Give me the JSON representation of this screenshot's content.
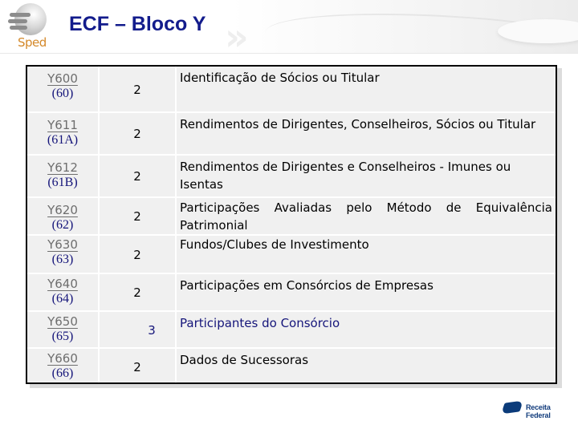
{
  "header": {
    "title": "ECF – Bloco Y",
    "logo_text": "Sped",
    "logo_icon": "sped-globe-icon"
  },
  "table": {
    "rows": [
      {
        "code": "Y600",
        "subcode": "(60)",
        "level": "2",
        "description": "Identificação de Sócios ou Titular"
      },
      {
        "code": "Y611",
        "subcode": "(61A)",
        "level": "2",
        "description": "Rendimentos de Dirigentes, Conselheiros, Sócios ou Titular"
      },
      {
        "code": "Y612",
        "subcode": "(61B)",
        "level": "2",
        "description": "Rendimentos de Dirigentes e Conselheiros - Imunes ou Isentas"
      },
      {
        "code": "Y620",
        "subcode": "(62)",
        "level": "2",
        "description": "Participações Avaliadas pelo Método de Equivalência Patrimonial"
      },
      {
        "code": "Y630",
        "subcode": "(63)",
        "level": "2",
        "description": "Fundos/Clubes de Investimento"
      },
      {
        "code": "Y640",
        "subcode": "(64)",
        "level": "2",
        "description": "Participações em Consórcios de Empresas"
      },
      {
        "code": "Y650",
        "subcode": "(65)",
        "level": "3",
        "description": "Participantes do Consórcio"
      },
      {
        "code": "Y660",
        "subcode": "(66)",
        "level": "2",
        "description": "Dados de Sucessoras"
      }
    ]
  },
  "footer": {
    "logo_text": "Receita Federal",
    "logo_icon": "receita-federal-icon"
  },
  "colors": {
    "title": "#131c8c",
    "subcode": "#15157a",
    "code_link": "#6e6e6e",
    "cell_bg": "#f0f0f0",
    "level3_text": "#15157a"
  }
}
